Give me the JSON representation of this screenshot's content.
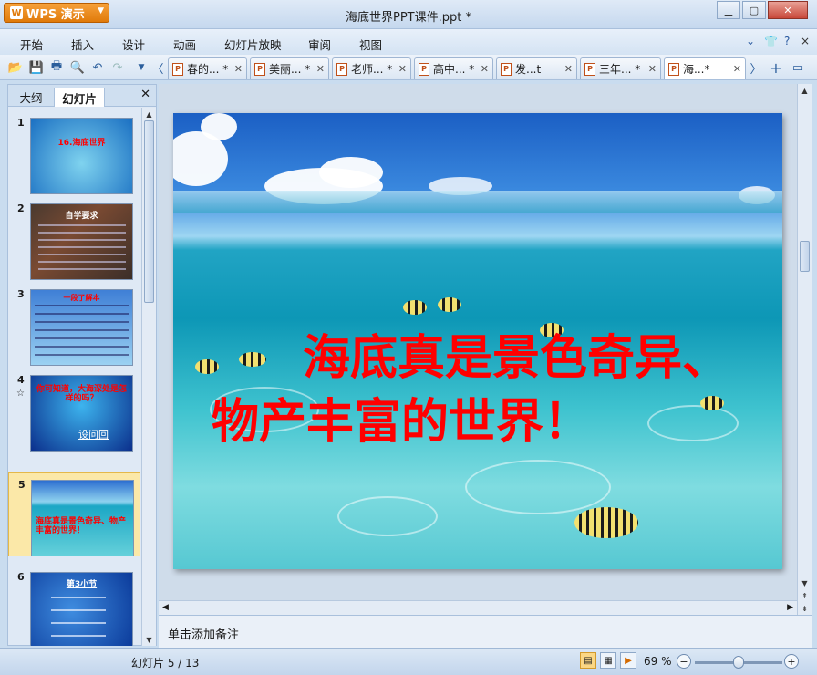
{
  "app": {
    "brand": "WPS 演示",
    "window_title": "海底世界PPT课件.ppt *"
  },
  "menu": [
    "开始",
    "插入",
    "设计",
    "动画",
    "幻灯片放映",
    "审阅",
    "视图"
  ],
  "tabs": [
    {
      "label": "春的... *"
    },
    {
      "label": "美丽... *"
    },
    {
      "label": "老师... *"
    },
    {
      "label": "高中... *"
    },
    {
      "label": "发...t"
    },
    {
      "label": "三年... *"
    },
    {
      "label": "海...*"
    }
  ],
  "side_panel": {
    "tabs": [
      "大纲",
      "幻灯片"
    ],
    "active_tab": "幻灯片",
    "slides": [
      {
        "num": "1",
        "caption": "16.海底世界"
      },
      {
        "num": "2",
        "caption": "自学要求"
      },
      {
        "num": "3",
        "caption": "一段了解本"
      },
      {
        "num": "4",
        "caption": "你可知道，大海深处是怎样的吗？",
        "link": "设问回"
      },
      {
        "num": "5",
        "caption": "海底真是景色奇异、物产丰富的世界！"
      },
      {
        "num": "6",
        "caption": "第3小节"
      }
    ]
  },
  "slide": {
    "line1": "海底真是景色奇异、",
    "line2": "物产丰富的世界！",
    "text_color": "#ff0000"
  },
  "notes_placeholder": "单击添加备注",
  "status": {
    "slide_counter": "幻灯片 5 / 13",
    "zoom_label": "69 %",
    "zoom_level": 0.5
  },
  "colors": {
    "accent": "#e07a0a",
    "selection": "#fbe8a8"
  }
}
